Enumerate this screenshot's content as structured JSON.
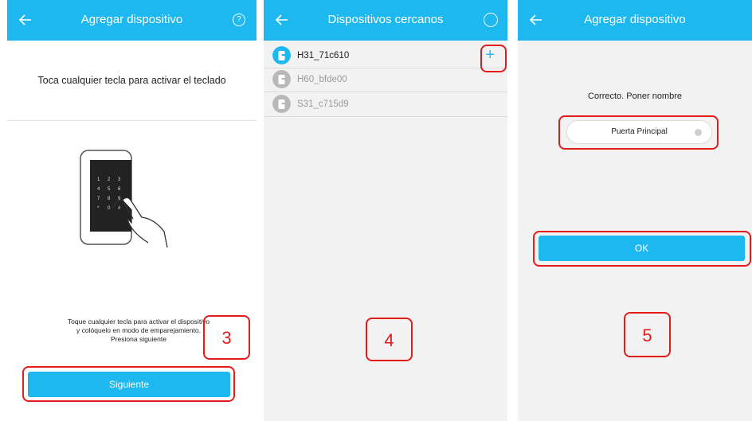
{
  "screen1": {
    "title": "Agregar dispositivo",
    "help_icon": "?",
    "prompt": "Toca cualquier tecla para activar el teclado",
    "instructions": [
      "Toque cualquier tecla para activar el dispositivo",
      "y colóquelo en modo de emparejamiento.",
      "Presiona siguiente"
    ],
    "next_label": "Siguiente",
    "step": "3",
    "keypad_keys": [
      "1",
      "2",
      "3",
      "4",
      "5",
      "6",
      "7",
      "8",
      "9",
      "*",
      "0",
      "#"
    ]
  },
  "screen2": {
    "title": "Dispositivos cercanos",
    "devices": [
      {
        "name": "H31_71c610",
        "active": true
      },
      {
        "name": "H60_bfde00",
        "active": false
      },
      {
        "name": "S31_c715d9",
        "active": false
      }
    ],
    "add_icon": "+",
    "step": "4"
  },
  "screen3": {
    "title": "Agregar dispositivo",
    "prompt": "Correcto. Poner nombre",
    "name_value": "Puerta Principal",
    "ok_label": "OK",
    "step": "5"
  },
  "colors": {
    "accent": "#1db8f0",
    "highlight": "#e31b1b",
    "device_inactive": "#b8b8b8"
  }
}
